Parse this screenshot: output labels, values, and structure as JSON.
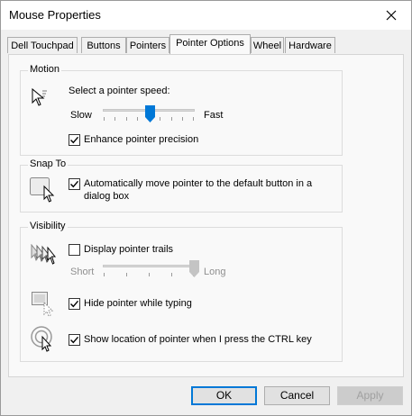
{
  "window": {
    "title": "Mouse Properties"
  },
  "tabs": [
    "Dell Touchpad",
    "Buttons",
    "Pointers",
    "Pointer Options",
    "Wheel",
    "Hardware"
  ],
  "active_tab": "Pointer Options",
  "motion": {
    "legend": "Motion",
    "speed_label": "Select a pointer speed:",
    "slow_label": "Slow",
    "fast_label": "Fast",
    "speed_value": 0.5,
    "enhance_label": "Enhance pointer precision",
    "enhance_checked": true
  },
  "snap_to": {
    "legend": "Snap To",
    "auto_line1": "Automatically move pointer to the default button in a",
    "auto_line2": "dialog box",
    "auto_checked": true
  },
  "visibility": {
    "legend": "Visibility",
    "trails_label": "Display pointer trails",
    "trails_checked": false,
    "short_label": "Short",
    "long_label": "Long",
    "trail_value": 1.0,
    "hide_label": "Hide pointer while typing",
    "hide_checked": true,
    "ctrl_label": "Show location of pointer when I press the CTRL key",
    "ctrl_checked": true
  },
  "buttons": {
    "ok": "OK",
    "cancel": "Cancel",
    "apply": "Apply"
  },
  "colors": {
    "accent": "#0078d7",
    "disabled_text": "#a0a0a0"
  },
  "icons": [
    "close-icon",
    "pointer-speed-icon",
    "snap-to-icon",
    "pointer-trails-icon",
    "hide-pointer-icon",
    "pointer-location-icon",
    "checkmark-icon",
    "slider-thumb-icon"
  ]
}
